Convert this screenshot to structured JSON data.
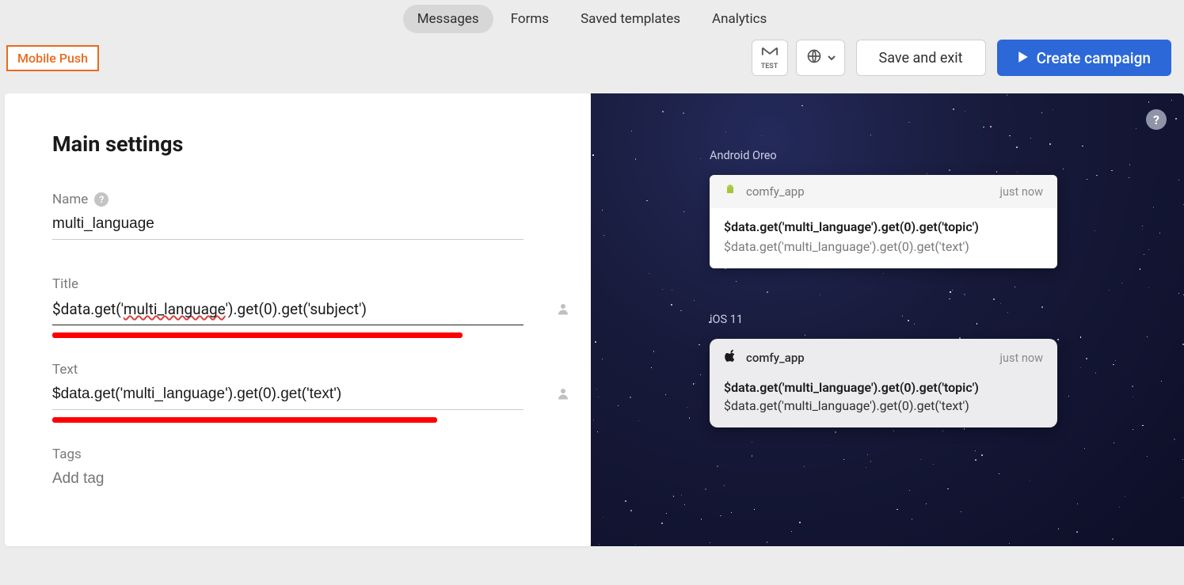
{
  "nav": {
    "items": [
      "Messages",
      "Forms",
      "Saved templates",
      "Analytics"
    ]
  },
  "header": {
    "badge": "Mobile Push",
    "test_label": "TEST",
    "save_and_exit": "Save and exit",
    "create_campaign": "Create campaign"
  },
  "form": {
    "section_title": "Main settings",
    "name_label": "Name",
    "name_value": "multi_language",
    "title_label": "Title",
    "title_value": "$data.get('multi_language').get(0).get('subject')",
    "text_label": "Text",
    "text_value": "$data.get('multi_language').get(0).get('text')",
    "tags_label": "Tags",
    "tags_placeholder": "Add tag"
  },
  "preview": {
    "android_label": "Android Oreo",
    "ios_label": "iOS 11",
    "app_name": "comfy_app",
    "time": "just now",
    "notif_title": "$data.get('multi_language').get(0).get('topic')",
    "notif_text": "$data.get('multi_language').get(0).get('text')"
  }
}
